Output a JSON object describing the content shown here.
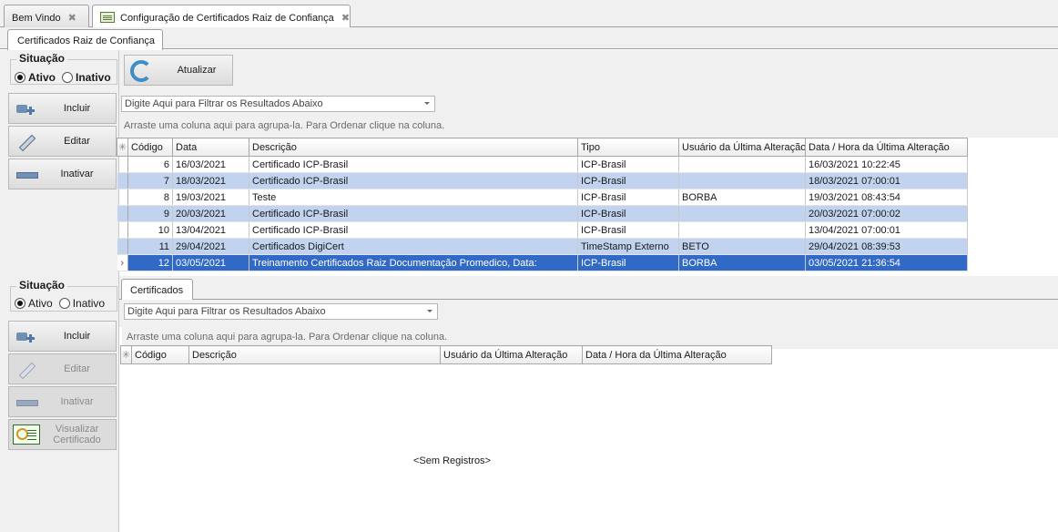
{
  "doc_tabs": [
    {
      "label": "Bem Vindo"
    },
    {
      "label": "Configuração de Certificados Raiz de Confiança"
    }
  ],
  "sub_tab": "Certificados Raiz de Confiança",
  "left_top": {
    "situacao_label": "Situação",
    "options": {
      "ativo": "Ativo",
      "inativo": "Inativo"
    },
    "selected": "Ativo",
    "buttons": {
      "incluir": "Incluir",
      "editar": "Editar",
      "inativar": "Inativar"
    }
  },
  "left_bottom": {
    "situacao_label": "Situação",
    "options": {
      "ativo": "Ativo",
      "inativo": "Inativo"
    },
    "selected": "Ativo",
    "buttons": {
      "incluir": "Incluir",
      "editar": "Editar",
      "inativar": "Inativar",
      "visualizar_l1": "Visualizar",
      "visualizar_l2": "Certificado"
    }
  },
  "toolbar": {
    "atualizar": "Atualizar"
  },
  "filter_placeholder": "Digite Aqui para Filtrar os Resultados Abaixo",
  "group_hint": "Arraste uma coluna aqui para agrupa-la. Para Ordenar clique na coluna.",
  "top_grid": {
    "columns": [
      "Código",
      "Data",
      "Descrição",
      "Tipo",
      "Usuário da Última Alteração",
      "Data / Hora da Última Alteração"
    ],
    "rows": [
      [
        "6",
        "16/03/2021",
        "Certificado ICP-Brasil",
        "ICP-Brasil",
        "",
        "16/03/2021 10:22:45"
      ],
      [
        "7",
        "18/03/2021",
        "Certificado ICP-Brasil",
        "ICP-Brasil",
        "",
        "18/03/2021 07:00:01"
      ],
      [
        "8",
        "19/03/2021",
        "Teste",
        "ICP-Brasil",
        "BORBA",
        "19/03/2021 08:43:54"
      ],
      [
        "9",
        "20/03/2021",
        "Certificado ICP-Brasil",
        "ICP-Brasil",
        "",
        "20/03/2021 07:00:02"
      ],
      [
        "10",
        "13/04/2021",
        "Certificado ICP-Brasil",
        "ICP-Brasil",
        "",
        "13/04/2021 07:00:01"
      ],
      [
        "11",
        "29/04/2021",
        "Certificados DigiCert",
        "TimeStamp Externo",
        "BETO",
        "29/04/2021 08:39:53"
      ],
      [
        "12",
        "03/05/2021",
        "Treinamento Certificados Raiz Documentação Promedico, Data:",
        "ICP-Brasil",
        "BORBA",
        "03/05/2021 21:36:54"
      ]
    ],
    "selected_row": 6
  },
  "lower": {
    "tab": "Certificados",
    "filter_placeholder": "Digite Aqui para Filtrar os Resultados Abaixo",
    "group_hint": "Arraste uma coluna aqui para agrupa-la. Para Ordenar clique na coluna.",
    "columns": [
      "Código",
      "Descrição",
      "Usuário da Última Alteração",
      "Data / Hora da Última Alteração"
    ],
    "empty_text": "<Sem Registros>"
  }
}
